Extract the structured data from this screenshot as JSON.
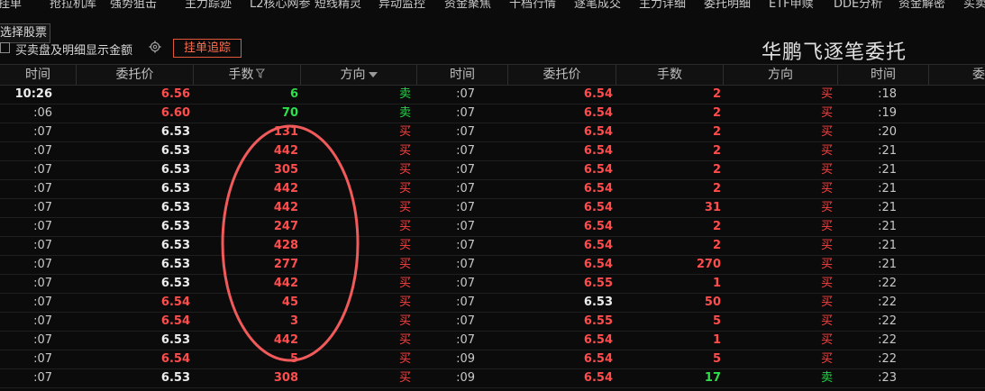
{
  "top_nav": {
    "tabs": [
      "挂单",
      "抢拉机库",
      "强势狙击",
      "主力踪迹",
      "L2核心网参",
      "短线精灵",
      "异动监控",
      "资金聚焦",
      "十档行情",
      "逐笔成交",
      "主力详细",
      "委托明细",
      "ETF申赎",
      "DDE分析",
      "资金解密",
      "买卖"
    ]
  },
  "toolbar": {
    "select_stock_label": "选择股票",
    "show_detail_label": "买卖盘及明细显示金额",
    "pending_button_label": "挂单追踪"
  },
  "panel_title": "华鹏飞逐笔委托",
  "columns": {
    "time": "时间",
    "price": "委托价",
    "quantity": "手数",
    "direction": "方向",
    "group3_price": "委"
  },
  "colors": {
    "buy": "#ff4242",
    "sell": "#22d845",
    "highlight_ellipse": "#f05a5a"
  },
  "group1": [
    {
      "time": "10:26",
      "price": "6.56",
      "price_color": "r",
      "qty": "6",
      "qty_color": "g",
      "dir": "卖"
    },
    {
      "time": ":06",
      "price": "6.60",
      "price_color": "r",
      "qty": "70",
      "qty_color": "g",
      "dir": "卖"
    },
    {
      "time": ":07",
      "price": "6.53",
      "price_color": "w",
      "qty": "131",
      "qty_color": "r",
      "dir": "买"
    },
    {
      "time": ":07",
      "price": "6.53",
      "price_color": "w",
      "qty": "442",
      "qty_color": "r",
      "dir": "买"
    },
    {
      "time": ":07",
      "price": "6.53",
      "price_color": "w",
      "qty": "305",
      "qty_color": "r",
      "dir": "买"
    },
    {
      "time": ":07",
      "price": "6.53",
      "price_color": "w",
      "qty": "442",
      "qty_color": "r",
      "dir": "买"
    },
    {
      "time": ":07",
      "price": "6.53",
      "price_color": "w",
      "qty": "442",
      "qty_color": "r",
      "dir": "买"
    },
    {
      "time": ":07",
      "price": "6.53",
      "price_color": "w",
      "qty": "247",
      "qty_color": "r",
      "dir": "买"
    },
    {
      "time": ":07",
      "price": "6.53",
      "price_color": "w",
      "qty": "428",
      "qty_color": "r",
      "dir": "买"
    },
    {
      "time": ":07",
      "price": "6.53",
      "price_color": "w",
      "qty": "277",
      "qty_color": "r",
      "dir": "买"
    },
    {
      "time": ":07",
      "price": "6.53",
      "price_color": "w",
      "qty": "442",
      "qty_color": "r",
      "dir": "买"
    },
    {
      "time": ":07",
      "price": "6.54",
      "price_color": "r",
      "qty": "45",
      "qty_color": "r",
      "dir": "买"
    },
    {
      "time": ":07",
      "price": "6.54",
      "price_color": "r",
      "qty": "3",
      "qty_color": "r",
      "dir": "买"
    },
    {
      "time": ":07",
      "price": "6.53",
      "price_color": "w",
      "qty": "442",
      "qty_color": "r",
      "dir": "买"
    },
    {
      "time": ":07",
      "price": "6.54",
      "price_color": "r",
      "qty": "5",
      "qty_color": "r",
      "dir": "买"
    },
    {
      "time": ":07",
      "price": "6.53",
      "price_color": "w",
      "qty": "308",
      "qty_color": "r",
      "dir": "买"
    }
  ],
  "group2": [
    {
      "time": ":07",
      "price": "6.54",
      "price_color": "r",
      "qty": "2",
      "qty_color": "r",
      "dir": "买"
    },
    {
      "time": ":07",
      "price": "6.54",
      "price_color": "r",
      "qty": "2",
      "qty_color": "r",
      "dir": "买"
    },
    {
      "time": ":07",
      "price": "6.54",
      "price_color": "r",
      "qty": "2",
      "qty_color": "r",
      "dir": "买"
    },
    {
      "time": ":07",
      "price": "6.54",
      "price_color": "r",
      "qty": "2",
      "qty_color": "r",
      "dir": "买"
    },
    {
      "time": ":07",
      "price": "6.54",
      "price_color": "r",
      "qty": "2",
      "qty_color": "r",
      "dir": "买"
    },
    {
      "time": ":07",
      "price": "6.54",
      "price_color": "r",
      "qty": "2",
      "qty_color": "r",
      "dir": "买"
    },
    {
      "time": ":07",
      "price": "6.54",
      "price_color": "r",
      "qty": "31",
      "qty_color": "r",
      "dir": "买"
    },
    {
      "time": ":07",
      "price": "6.54",
      "price_color": "r",
      "qty": "2",
      "qty_color": "r",
      "dir": "买"
    },
    {
      "time": ":07",
      "price": "6.54",
      "price_color": "r",
      "qty": "2",
      "qty_color": "r",
      "dir": "买"
    },
    {
      "time": ":07",
      "price": "6.54",
      "price_color": "r",
      "qty": "270",
      "qty_color": "r",
      "dir": "买"
    },
    {
      "time": ":07",
      "price": "6.55",
      "price_color": "r",
      "qty": "1",
      "qty_color": "r",
      "dir": "买"
    },
    {
      "time": ":07",
      "price": "6.53",
      "price_color": "w",
      "qty": "50",
      "qty_color": "r",
      "dir": "买"
    },
    {
      "time": ":07",
      "price": "6.55",
      "price_color": "r",
      "qty": "5",
      "qty_color": "r",
      "dir": "买"
    },
    {
      "time": ":07",
      "price": "6.54",
      "price_color": "r",
      "qty": "1",
      "qty_color": "r",
      "dir": "买"
    },
    {
      "time": ":09",
      "price": "6.54",
      "price_color": "r",
      "qty": "5",
      "qty_color": "r",
      "dir": "买"
    },
    {
      "time": ":09",
      "price": "6.54",
      "price_color": "r",
      "qty": "17",
      "qty_color": "g",
      "dir": "卖"
    }
  ],
  "group3_times": [
    ":18",
    ":19",
    ":20",
    ":21",
    ":21",
    ":21",
    ":21",
    ":21",
    ":21",
    ":21",
    ":22",
    ":22",
    ":22",
    ":22",
    ":22",
    ":23"
  ]
}
